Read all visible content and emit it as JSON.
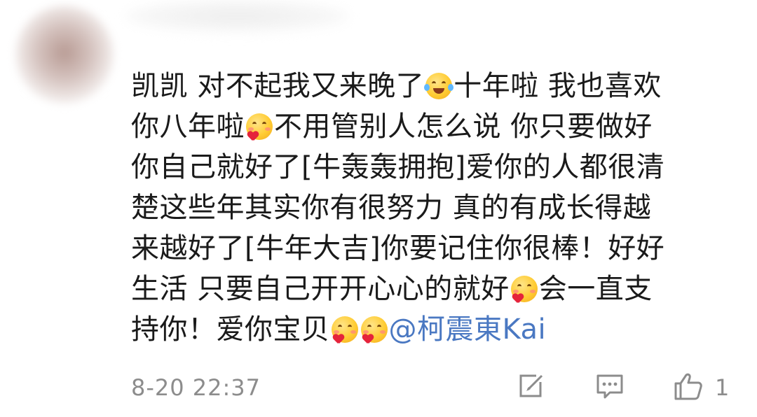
{
  "comment": {
    "lines": [
      [
        "凯凯 对不起我又来晚了",
        "十年啦 我也喜欢"
      ],
      [
        "你八年啦",
        "不用管别人怎么说 你只要做好"
      ],
      [
        "你自己就好了[牛轰轰拥抱]爱你的人都很清"
      ],
      [
        "楚这些年其实你有很努力 真的有成长得越"
      ],
      [
        "来越好了[牛年大吉]你要记住你很棒！好好"
      ],
      [
        "生活 只要自己开开心心的就好",
        "会一直支"
      ],
      [
        "持你！爱你宝贝",
        "@柯震東Kai"
      ]
    ],
    "emoji": [
      "laugh-cry-emoji",
      "hug-heart-emoji",
      "love-heart-emoji"
    ]
  },
  "footer": {
    "timestamp": "8-20 22:37",
    "like_count": "1"
  },
  "icons": {
    "repost": "repost-icon",
    "reply": "comment-icon",
    "like": "thumbs-up-icon"
  }
}
